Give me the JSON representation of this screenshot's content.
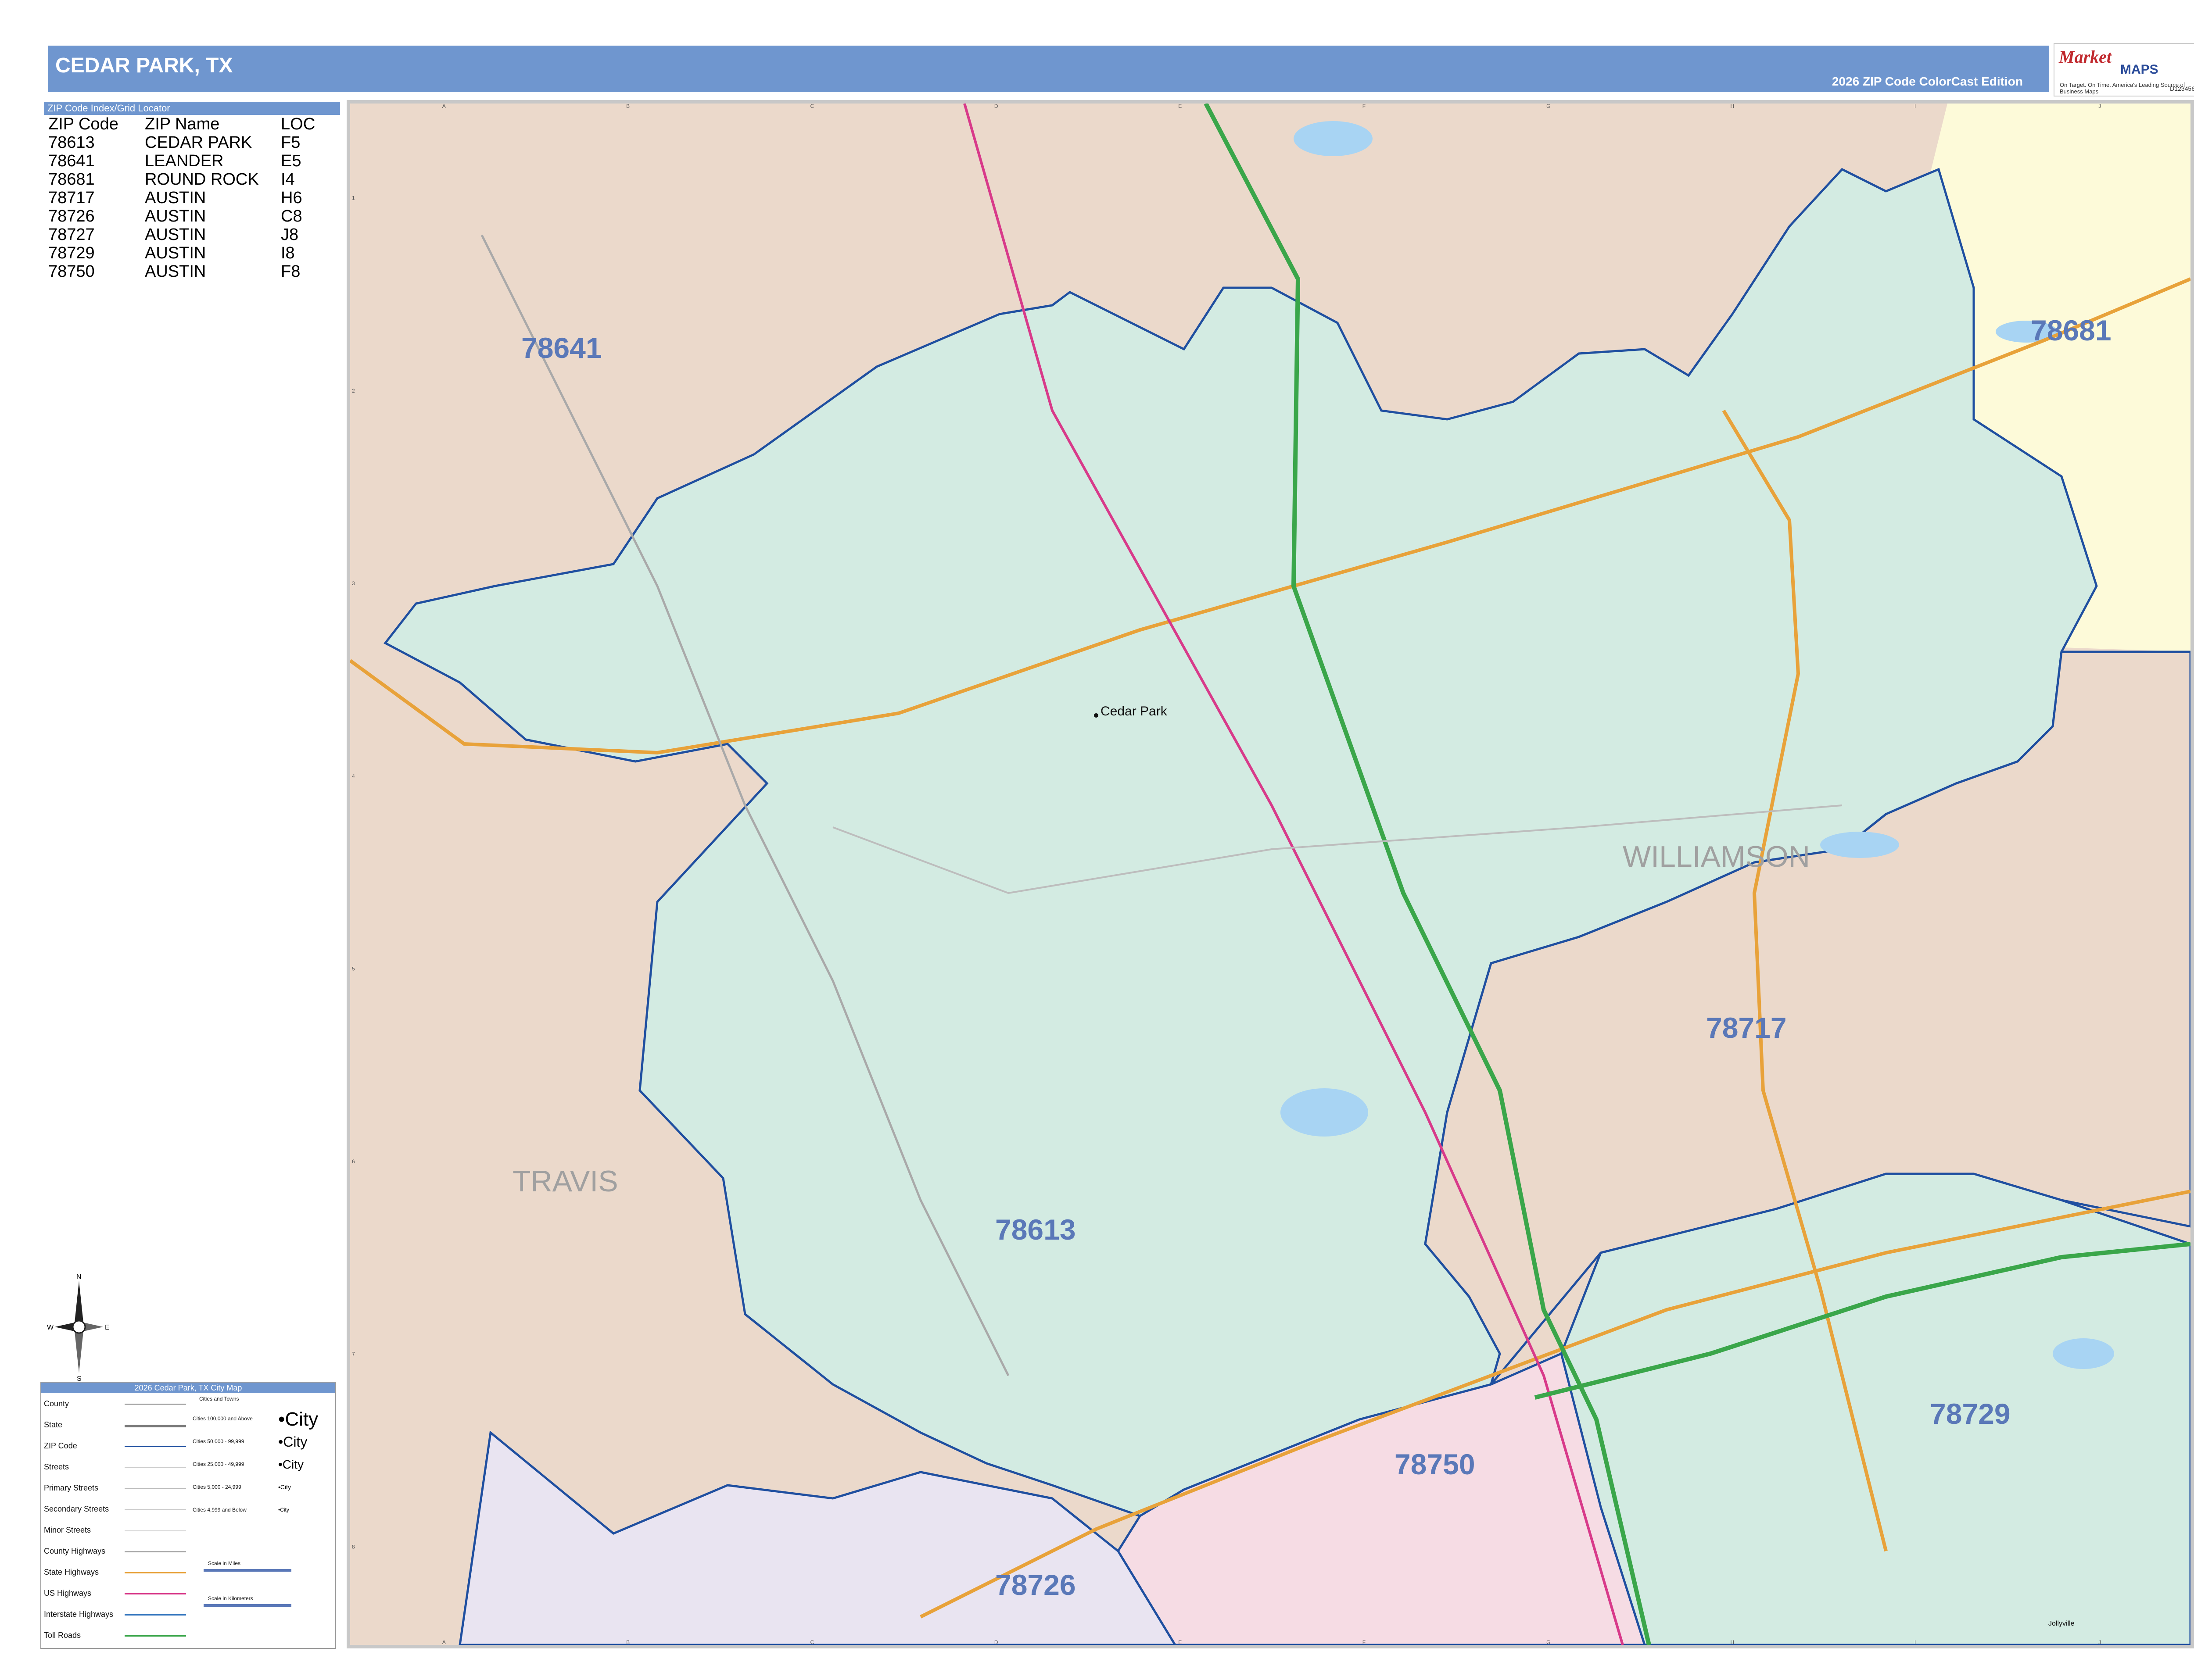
{
  "header": {
    "title": "CEDAR PARK, TX",
    "edition": "2026 ZIP Code ColorCast Edition"
  },
  "logo": {
    "brand1": "Market",
    "brand2": "MAPS",
    "tagline": "On Target.  On Time.",
    "slogan": "America's Leading Source of Business Maps",
    "code": "D123456"
  },
  "zip_index": {
    "title": "ZIP Code Index/Grid Locator",
    "columns": [
      "ZIP Code",
      "ZIP Name",
      "LOC"
    ],
    "rows": [
      [
        "78613",
        "CEDAR PARK",
        "F5"
      ],
      [
        "78641",
        "LEANDER",
        "E5"
      ],
      [
        "78681",
        "ROUND ROCK",
        "I4"
      ],
      [
        "78717",
        "AUSTIN",
        "H6"
      ],
      [
        "78726",
        "AUSTIN",
        "C8"
      ],
      [
        "78727",
        "AUSTIN",
        "J8"
      ],
      [
        "78729",
        "AUSTIN",
        "I8"
      ],
      [
        "78750",
        "AUSTIN",
        "F8"
      ]
    ]
  },
  "map": {
    "zip_labels": [
      "78641",
      "78681",
      "78717",
      "78613",
      "78729",
      "78750",
      "78726"
    ],
    "county_labels": [
      "TRAVIS",
      "WILLIAMSON"
    ],
    "place_labels": [
      "Cedar Park",
      "Jollyville"
    ],
    "grid_columns": [
      "A",
      "B",
      "C",
      "D",
      "E",
      "F",
      "G",
      "H",
      "I",
      "J"
    ],
    "grid_rows": [
      "1",
      "2",
      "3",
      "4",
      "5",
      "6",
      "7",
      "8"
    ],
    "colors": {
      "zip_78613": "#d3ebe2",
      "zip_78641": "#ebd9cb",
      "zip_78681": "#fdfad9",
      "zip_78717": "#ebd9cb",
      "zip_78729": "#d3ebe2",
      "zip_78750": "#f6dce4",
      "zip_78726": "#e9e4f1",
      "travis": "#ebd9cb",
      "water": "#a8d4f3",
      "zip_boundary": "#1f4fa0",
      "label": "#5a78b8",
      "us_highway": "#d83a8a",
      "interstate": "#3aa64a",
      "state_highway": "#e8a23a"
    }
  },
  "compass": {
    "n": "N",
    "s": "S",
    "e": "E",
    "w": "W"
  },
  "legend": {
    "title": "2026 Cedar Park, TX City Map",
    "items": [
      "County",
      "State",
      "ZIP Code",
      "Streets",
      "Primary Streets",
      "Secondary Streets",
      "Minor Streets",
      "County Highways",
      "State Highways",
      "US Highways",
      "Interstate Highways",
      "Toll Roads"
    ],
    "cities_heading": "Cities and Towns",
    "city_rows": [
      "Cities 100,000 and Above",
      "Cities 50,000 - 99,999",
      "Cities 25,000 - 49,999",
      "Cities 5,000 - 24,999",
      "Cities 4,999 and Below"
    ],
    "city_word": "City",
    "scale_miles": "Scale in Miles",
    "scale_km": "Scale in Kilometers"
  }
}
